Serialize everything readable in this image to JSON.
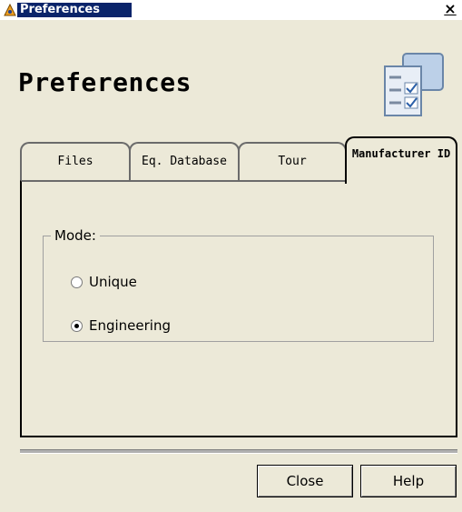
{
  "window": {
    "title": "Preferences"
  },
  "header": {
    "title": "Preferences"
  },
  "tabs": [
    {
      "label": "Files",
      "active": false
    },
    {
      "label": "Eq. Database",
      "active": false
    },
    {
      "label": "Tour",
      "active": false
    },
    {
      "label": "Manufacturer ID",
      "active": true
    }
  ],
  "mode": {
    "legend": "Mode:",
    "options": [
      {
        "label": "Unique",
        "checked": false
      },
      {
        "label": "Engineering",
        "checked": true
      }
    ]
  },
  "buttons": {
    "close": "Close",
    "help": "Help"
  },
  "icons": {
    "app": "app-icon",
    "header": "preferences-checklist-icon",
    "close": "close-icon"
  }
}
